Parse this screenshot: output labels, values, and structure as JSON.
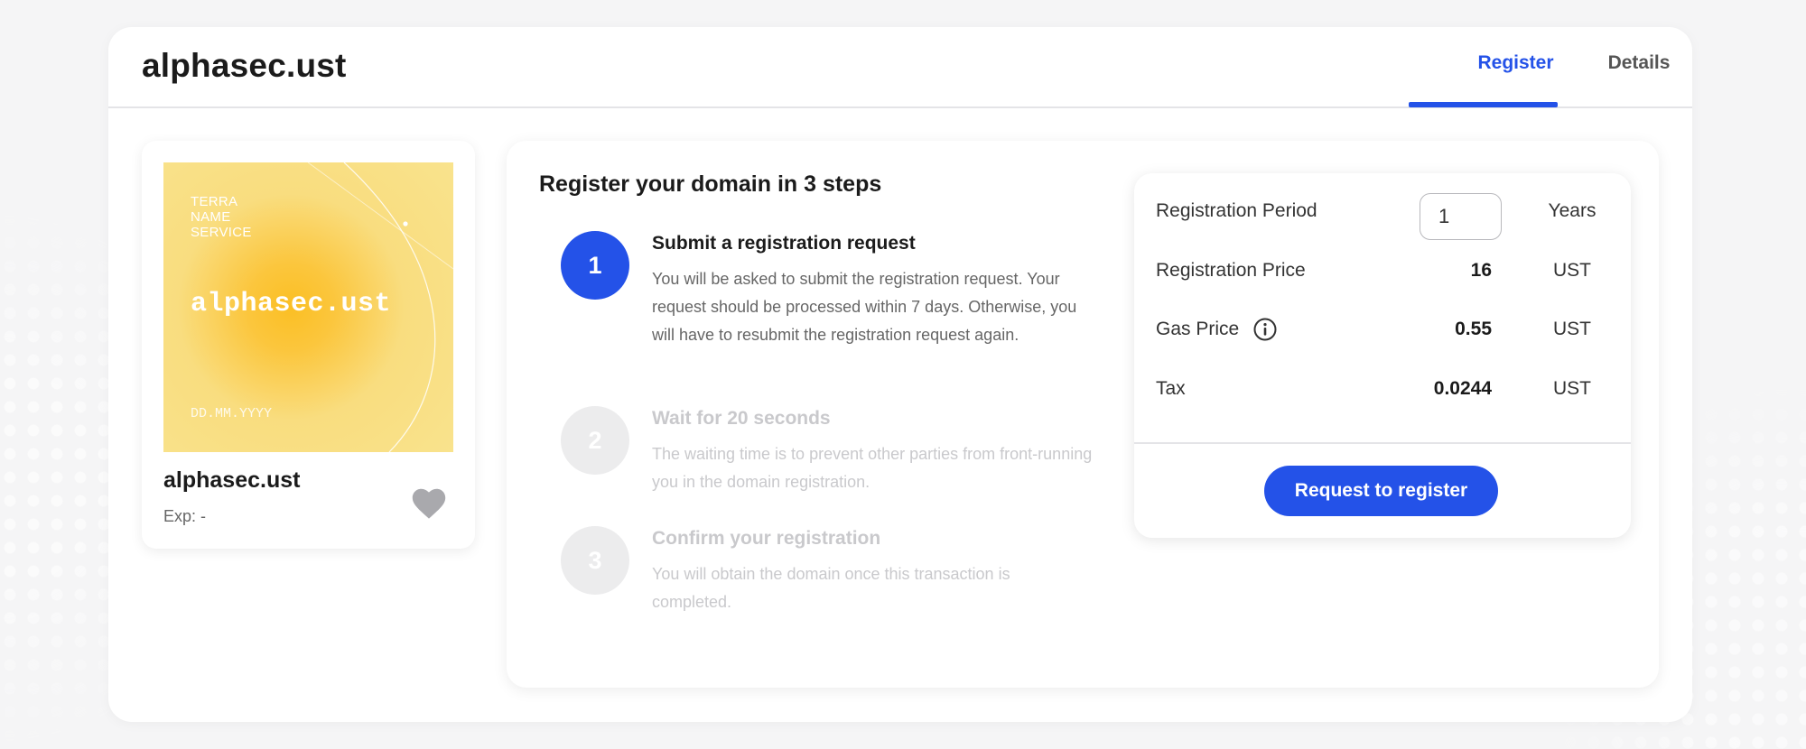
{
  "header": {
    "domain_title": "alphasec.ust",
    "tabs": [
      {
        "label": "Register",
        "active": true
      },
      {
        "label": "Details",
        "active": false
      }
    ]
  },
  "nft_card": {
    "image_text": {
      "line1": "TERRA",
      "line2": "NAME",
      "line3": "SERVICE",
      "domain": "alphasec.ust",
      "date": "DD.MM.YYYY"
    },
    "name": "alphasec.ust",
    "expiry": "Exp: -",
    "favorite_icon": "heart-icon"
  },
  "steps_panel": {
    "title": "Register your domain in 3 steps",
    "steps": [
      {
        "number": "1",
        "heading": "Submit a registration request",
        "description": "You will be asked to submit the registration request. Your request should be processed within 7 days. Otherwise, you will have to resubmit the registration request again.",
        "active": true
      },
      {
        "number": "2",
        "heading": "Wait for 20 seconds",
        "description": "The waiting time is to prevent other parties from front-running you in the domain registration.",
        "active": false
      },
      {
        "number": "3",
        "heading": "Confirm your registration",
        "description": "You will obtain the domain once this transaction is completed.",
        "active": false
      }
    ]
  },
  "registration": {
    "period": {
      "label": "Registration Period",
      "value": "1",
      "unit": "Years"
    },
    "price": {
      "label": "Registration Price",
      "value": "16",
      "unit": "UST"
    },
    "gas": {
      "label": "Gas Price",
      "value": "0.55",
      "unit": "UST",
      "icon": "info-icon"
    },
    "tax": {
      "label": "Tax",
      "value": "0.0244",
      "unit": "UST"
    },
    "button_label": "Request to register"
  },
  "colors": {
    "accent": "#2452e8",
    "nft_gradient_center": "#fbbf24",
    "nft_gradient_outer": "#f9e38d"
  }
}
